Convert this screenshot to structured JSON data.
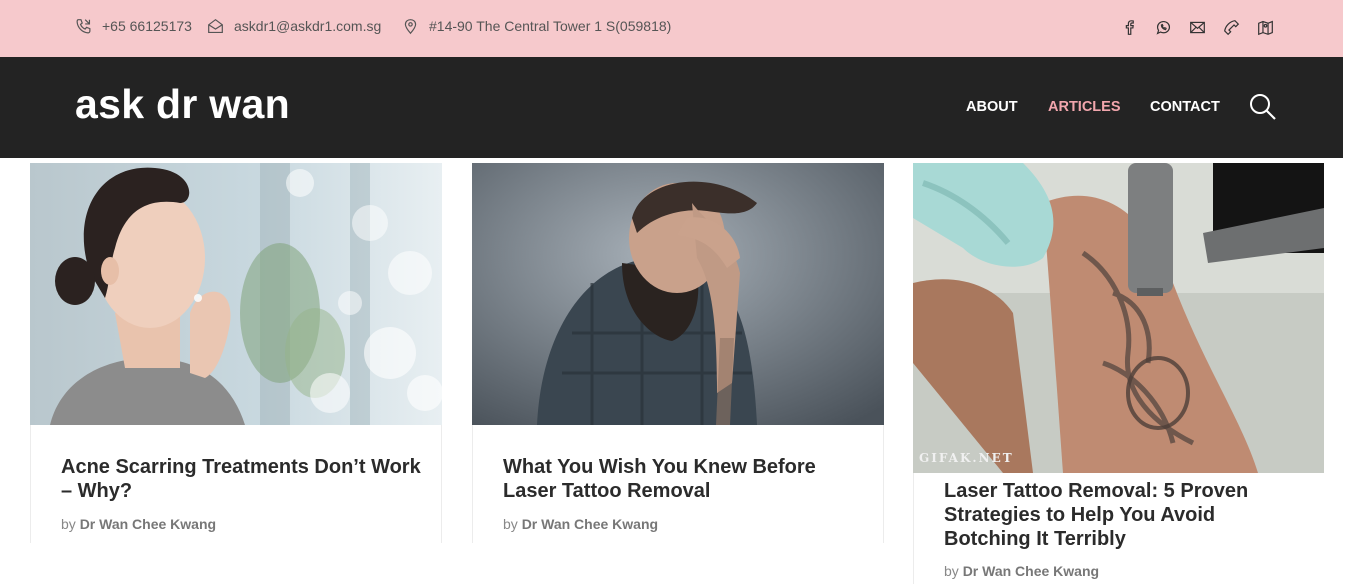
{
  "topbar": {
    "phone": "+65 66125173",
    "email": "askdr1@askdr1.com.sg",
    "address": "#14-90 The Central Tower 1 S(059818)",
    "social_icons": [
      "facebook-icon",
      "whatsapp-icon",
      "mail-icon",
      "phone-icon",
      "map-icon"
    ]
  },
  "header": {
    "logo": "ask dr wan",
    "nav": [
      "ABOUT",
      "ARTICLES",
      "CONTACT"
    ],
    "active_nav": "ARTICLES",
    "colors": {
      "topbar_bg": "#f6c9cc",
      "header_bg": "#232323",
      "active": "#f1a6ad"
    }
  },
  "articles": [
    {
      "title": "Acne Scarring Treatments Don’t Work – Why?",
      "by": "by",
      "author": "Dr Wan Chee Kwang"
    },
    {
      "title": "What You Wish You Knew Before Laser Tattoo Removal",
      "by": "by",
      "author": "Dr Wan Chee Kwang"
    },
    {
      "title": "Laser Tattoo Removal: 5 Proven Strategies to Help You Avoid Botching It Terribly",
      "by": "by",
      "author": "Dr Wan Chee Kwang",
      "image_watermark": "GIFAK.NET"
    }
  ]
}
